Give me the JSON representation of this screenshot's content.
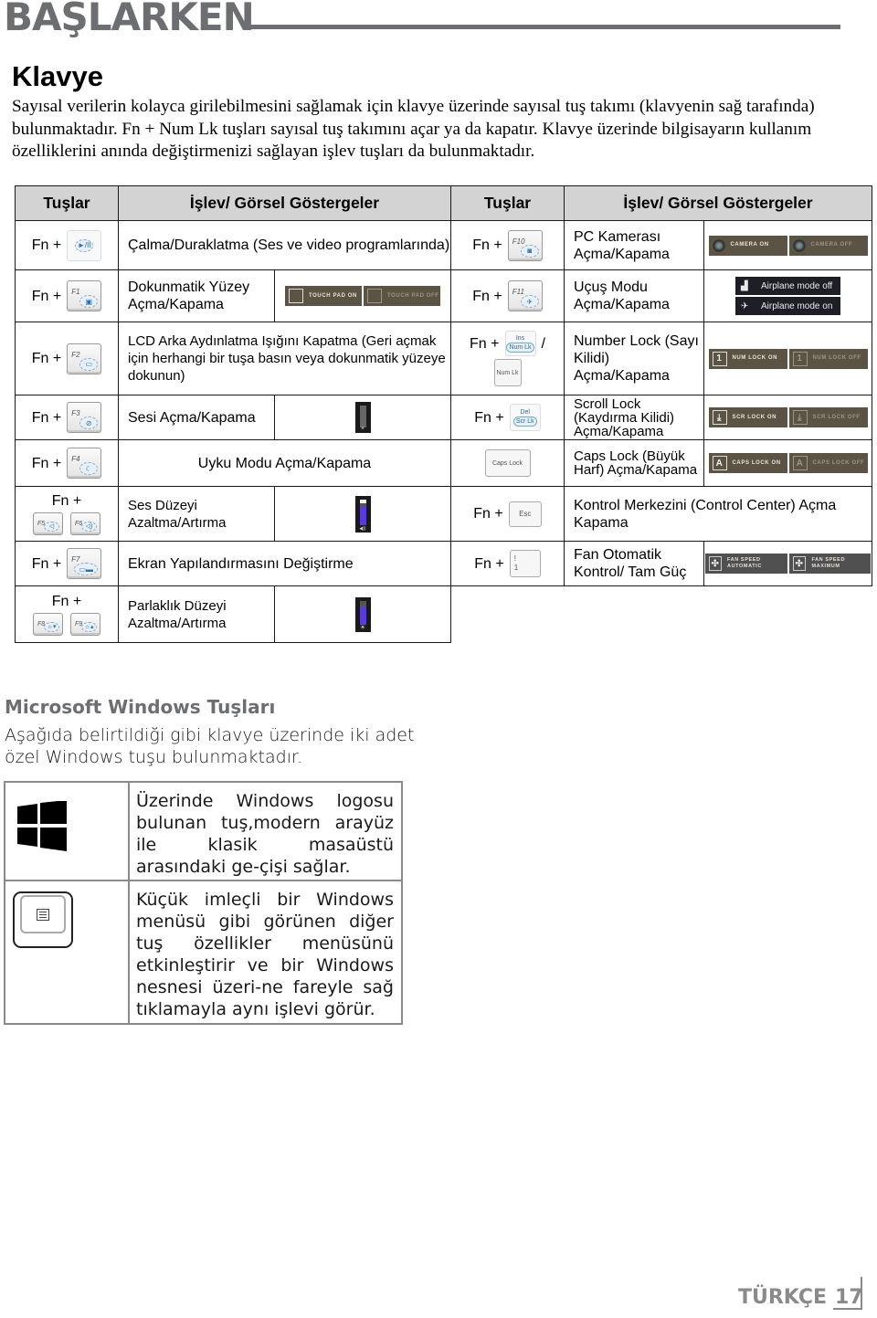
{
  "header": {
    "section_title": "BAŞLARKEN"
  },
  "keyboard": {
    "title": "Klavye",
    "intro": "Sayısal verilerin kolayca girilebilmesini sağlamak için klavye üzerinde sayısal tuş takımı (klavyenin sağ tarafında) bulunmaktadır. Fn + Num Lk tuşları sayısal tuş takımını açar ya da kapatır. Klavye üzerinde bilgisayarın kullanım özelliklerini anında değiştirmenizi sağlayan işlev tuşları da bulunmaktadır."
  },
  "table": {
    "headers": [
      "Tuşlar",
      "İşlev/ Görsel Göstergeler",
      "Tuşlar",
      "İşlev/ Görsel Göstergeler"
    ],
    "fn_label": "Fn +",
    "left_rows": [
      {
        "keys": [
          {
            "label": "",
            "icon": "play-pause"
          }
        ],
        "function": "Çalma/Duraklatma (Ses ve video programlarında)"
      },
      {
        "keys": [
          {
            "label": "F1",
            "icon": "touchpad"
          }
        ],
        "function": "Dokunmatik Yüzey Açma/Kapama",
        "indicators": [
          "TOUCH PAD ON",
          "TOUCH PAD OFF"
        ]
      },
      {
        "keys": [
          {
            "label": "F2",
            "icon": "backlight"
          }
        ],
        "function": "LCD Arka Aydınlatma Işığını Kapatma (Geri açmak için herhangi bir tuşa basın veya dokunmatik yüzeye dokunun)"
      },
      {
        "keys": [
          {
            "label": "F3",
            "icon": "mute"
          }
        ],
        "function": "Sesi Açma/Kapama",
        "indicator": {
          "type": "volume-muted",
          "level": 0,
          "symbol": "×"
        }
      },
      {
        "keys": [
          {
            "label": "F4",
            "icon": "sleep"
          }
        ],
        "function": "Uyku Modu Açma/Kapama"
      },
      {
        "keys": [
          {
            "label": "F5",
            "icon": "volume-down"
          },
          {
            "label": "F6",
            "icon": "volume-up"
          }
        ],
        "function": "Ses Düzeyi Azaltma/Artırma",
        "indicator": {
          "type": "volume",
          "level": 0.75,
          "symbol": "◀))"
        }
      },
      {
        "keys": [
          {
            "label": "F7",
            "icon": "display-switch"
          }
        ],
        "function": "Ekran Yapılandırmasını Değiştirme"
      },
      {
        "keys": [
          {
            "label": "F8",
            "icon": "brightness-down"
          },
          {
            "label": "F9",
            "icon": "brightness-up"
          }
        ],
        "function": "Parlaklık Düzeyi Azaltma/Artırma",
        "indicator": {
          "type": "brightness",
          "level": 0.8,
          "symbol": "☀"
        }
      }
    ],
    "right_rows": [
      {
        "keys": [
          {
            "label": "F10",
            "icon": "camera"
          }
        ],
        "function": "PC Kamerası Açma/Kapama",
        "indicators": [
          "CAMERA ON",
          "CAMERA OFF"
        ]
      },
      {
        "keys": [
          {
            "label": "F11",
            "icon": "airplane"
          }
        ],
        "function": "Uçuş Modu Açma/Kapama",
        "indicators": [
          "Airplane mode off",
          "Airplane mode on"
        ]
      },
      {
        "keys": [
          {
            "top": "Ins",
            "bottom": "Num Lk"
          },
          {
            "label": "Num Lk"
          }
        ],
        "separator": "/",
        "function": "Number Lock (Sayı Kilidi) Açma/Kapama",
        "indicators": [
          "NUM LOCK ON",
          "NUM LOCK OFF"
        ]
      },
      {
        "keys": [
          {
            "top": "Del",
            "bottom": "Scr Lk"
          }
        ],
        "function": "Scroll Lock (Kaydırma Kilidi) Açma/Kapama",
        "indicators": [
          "SCR LOCK ON",
          "SCR LOCK OFF"
        ]
      },
      {
        "keys": [
          {
            "label": "Caps Lock"
          }
        ],
        "function": "Caps Lock (Büyük Harf) Açma/Kapama",
        "indicators": [
          "CAPS LOCK ON",
          "CAPS LOCK OFF"
        ]
      },
      {
        "keys": [
          {
            "label": "Esc"
          }
        ],
        "function": "Kontrol Merkezini (Control Center) Açma Kapama"
      },
      {
        "keys": [
          {
            "top": "!",
            "bottom": "1"
          }
        ],
        "function": "Fan Otomatik Kontrol/ Tam Güç",
        "indicators": [
          "FAN SPEED AUTOMATIC",
          "FAN SPEED MAXIMUM"
        ]
      }
    ]
  },
  "windows": {
    "title": "Microsoft Windows Tuşları",
    "intro": "Aşağıda belirtildiği gibi klavye üzerinde iki adet özel Windows tuşu bulunmaktadır.",
    "rows": [
      {
        "icon": "windows-logo-icon",
        "text": "Üzerinde Windows logosu bulunan tuş,modern arayüz ile klasik masaüstü arasındaki ge-çişi sağlar."
      },
      {
        "icon": "menu-key-icon",
        "text": "Küçük imleçli bir Windows menüsü gibi görünen diğer tuş özellikler menüsünü etkinleştirir ve bir Windows nesnesi üzeri-ne fareyle sağ tıklamayla aynı işlevi görür."
      }
    ]
  },
  "footer": {
    "language": "TÜRKÇE",
    "page_number": "17"
  },
  "colors": {
    "heading_gray": "#6d6e71",
    "table_header_bg": "#d3d3d3",
    "osd_brown": "#5b5445",
    "airplane_bg": "#1e1f26",
    "meter_fill": "#5a3ad8"
  }
}
